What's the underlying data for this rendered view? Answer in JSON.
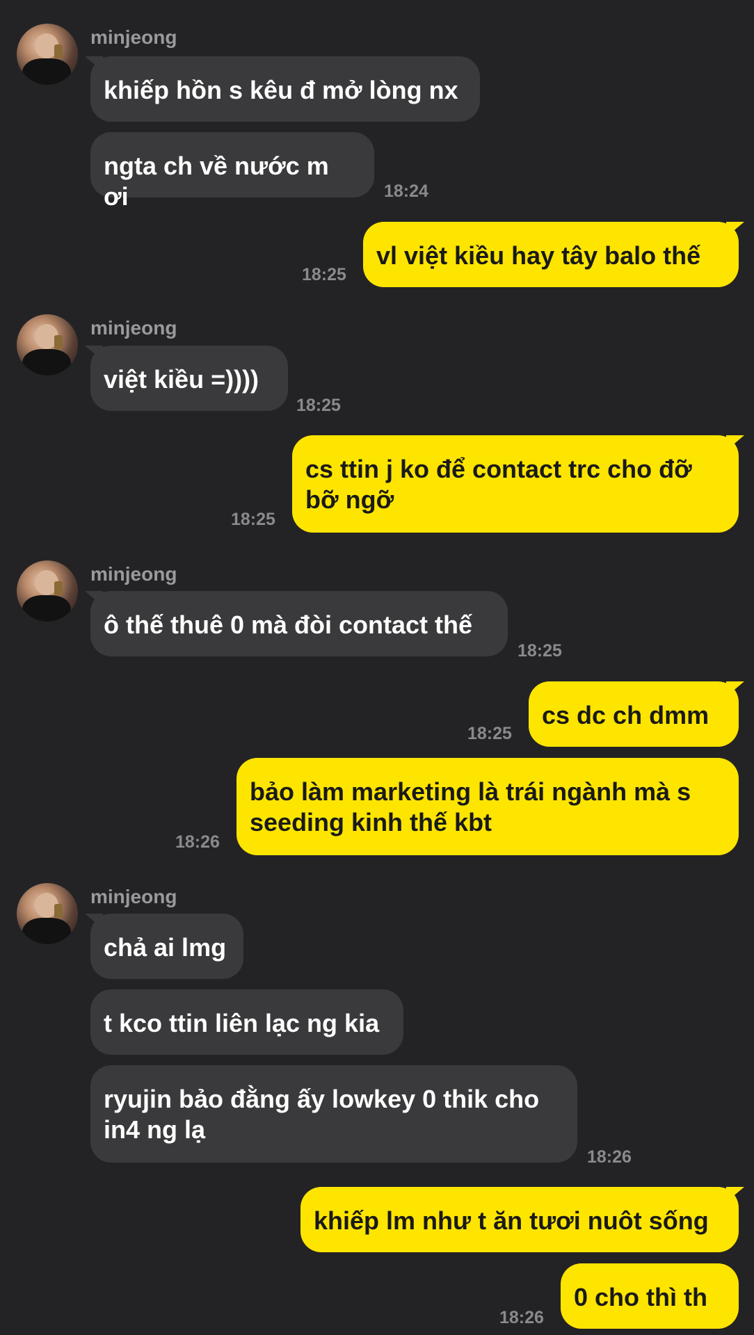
{
  "colors": {
    "background": "#232325",
    "incoming_bubble": "#3a3a3c",
    "outgoing_bubble": "#fde500",
    "timestamp": "#8a8a8c"
  },
  "sender_name": "minjeong",
  "messages": [
    {
      "dir": "in",
      "text": "khiếp hồn s kêu đ mở lòng nx"
    },
    {
      "dir": "in",
      "text": "ngta ch về nước m ơi",
      "time": "18:24"
    },
    {
      "dir": "out",
      "text": "vl việt kiều hay tây balo thế",
      "time": "18:25"
    },
    {
      "dir": "in",
      "text": "việt kiều =))))",
      "time": "18:25"
    },
    {
      "dir": "out",
      "text": "cs ttin j ko để contact trc cho đỡ bỡ ngỡ",
      "time": "18:25"
    },
    {
      "dir": "in",
      "text": "ô thế thuê 0 mà đòi contact thế",
      "time": "18:25"
    },
    {
      "dir": "out",
      "text": "cs dc ch dmm",
      "time": "18:25"
    },
    {
      "dir": "out",
      "text": "bảo làm marketing là trái ngành mà s seeding kinh thế kbt",
      "time": "18:26"
    },
    {
      "dir": "in",
      "text": "chả ai lmg"
    },
    {
      "dir": "in",
      "text": "t kco ttin liên lạc ng kia"
    },
    {
      "dir": "in",
      "text": "ryujin bảo đằng ấy lowkey 0 thik cho in4 ng lạ",
      "time": "18:26"
    },
    {
      "dir": "out",
      "text": "khiếp lm như t ăn tươi nuôt sống"
    },
    {
      "dir": "out",
      "text": "0 cho thì th",
      "time": "18:26"
    }
  ]
}
